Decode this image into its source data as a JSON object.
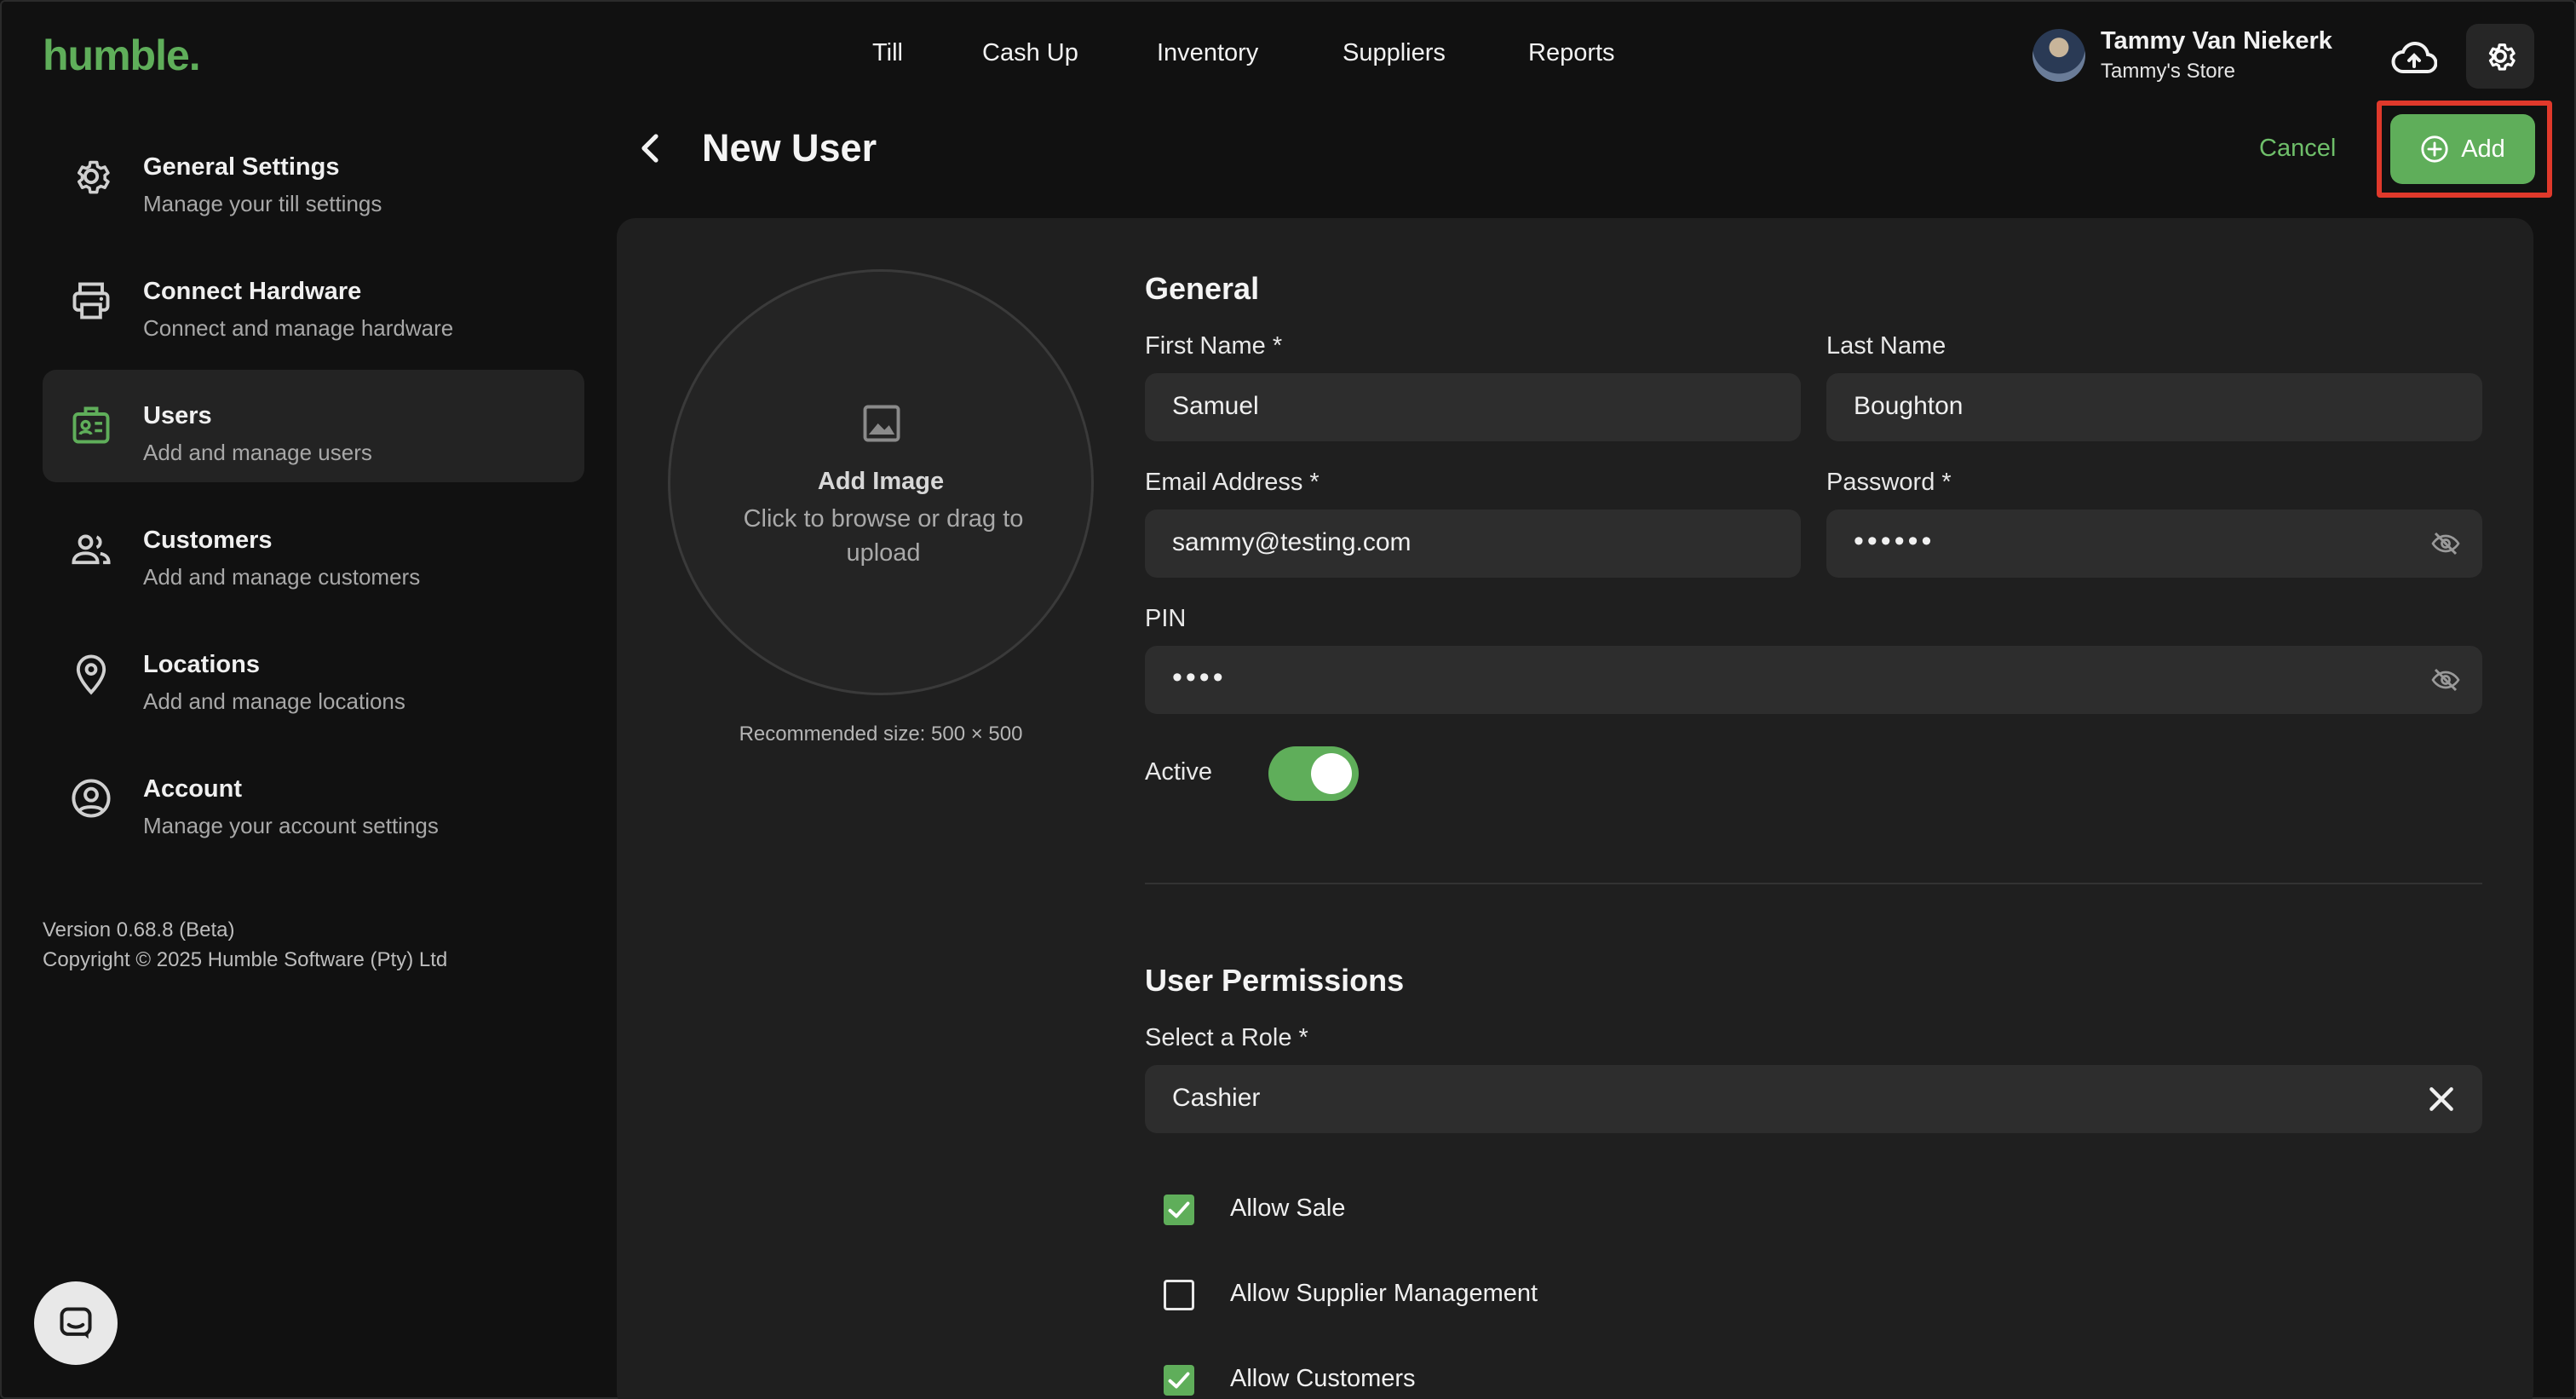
{
  "app": {
    "logo": "humble."
  },
  "topnav": {
    "items": [
      "Till",
      "Cash Up",
      "Inventory",
      "Suppliers",
      "Reports"
    ]
  },
  "user": {
    "name": "Tammy Van Niekerk",
    "store": "Tammy's Store"
  },
  "sidebar": {
    "items": [
      {
        "title": "General Settings",
        "subtitle": "Manage your till settings",
        "icon": "gear-icon"
      },
      {
        "title": "Connect Hardware",
        "subtitle": "Connect and manage hardware",
        "icon": "printer-icon"
      },
      {
        "title": "Users",
        "subtitle": "Add and manage users",
        "icon": "id-badge-icon",
        "active": true
      },
      {
        "title": "Customers",
        "subtitle": "Add and manage customers",
        "icon": "people-icon"
      },
      {
        "title": "Locations",
        "subtitle": "Add and manage locations",
        "icon": "location-pin-icon"
      },
      {
        "title": "Account",
        "subtitle": "Manage your account settings",
        "icon": "account-circle-icon"
      }
    ],
    "version": "Version 0.68.8 (Beta)",
    "copyright": "Copyright © 2025 Humble Software (Pty) Ltd"
  },
  "page": {
    "title": "New User",
    "cancel_label": "Cancel",
    "add_label": "Add"
  },
  "image_upload": {
    "title": "Add Image",
    "hint": "Click to browse or drag to upload",
    "recommended": "Recommended size: 500 × 500"
  },
  "general": {
    "section_title": "General",
    "first_name": {
      "label": "First Name *",
      "value": "Samuel"
    },
    "last_name": {
      "label": "Last Name",
      "value": "Boughton"
    },
    "email": {
      "label": "Email Address *",
      "value": "sammy@testing.com"
    },
    "password": {
      "label": "Password *",
      "masked": "••••••"
    },
    "pin": {
      "label": "PIN",
      "masked": "••••"
    },
    "active": {
      "label": "Active",
      "on": true
    }
  },
  "permissions": {
    "section_title": "User Permissions",
    "role": {
      "label": "Select a Role *",
      "value": "Cashier"
    },
    "items": [
      {
        "label": "Allow Sale",
        "checked": true
      },
      {
        "label": "Allow Supplier Management",
        "checked": false
      },
      {
        "label": "Allow Customers",
        "checked": true
      }
    ]
  },
  "colors": {
    "accent": "#5fae5a",
    "highlight": "#e0392b",
    "background": "#111111",
    "panel": "#1f1f1f"
  }
}
